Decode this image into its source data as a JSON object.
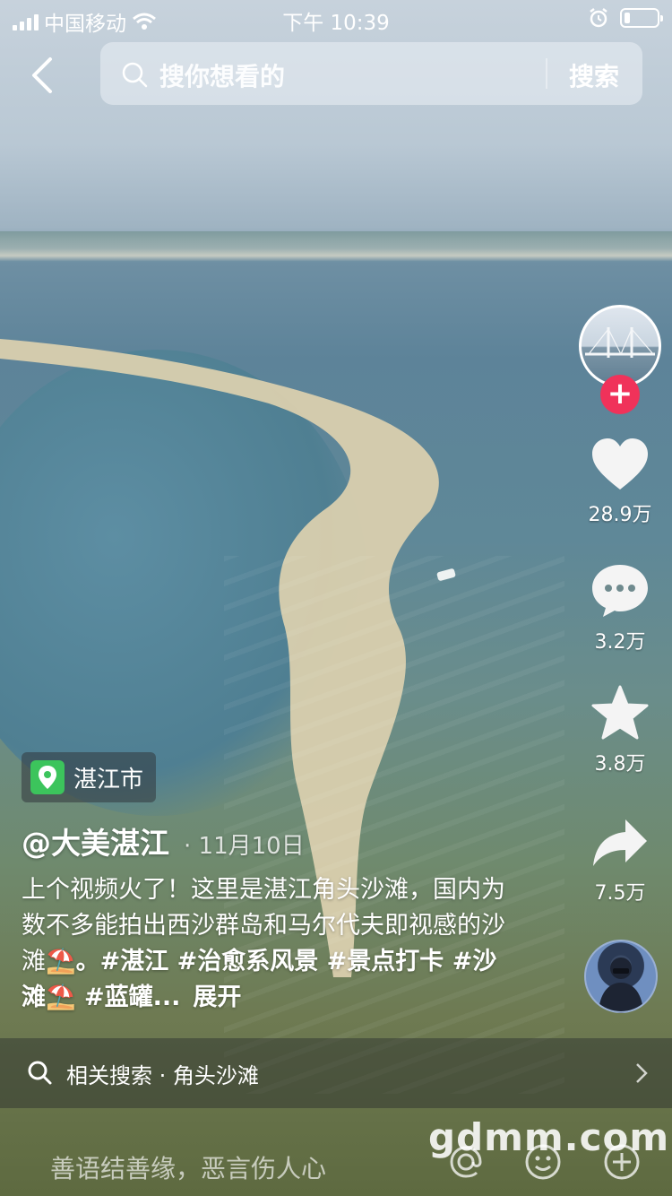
{
  "status_bar": {
    "carrier": "中国移动",
    "time": "下午 10:39",
    "battery_level": 0.18
  },
  "header": {
    "search_placeholder": "搜你想看的",
    "search_button": "搜索"
  },
  "actions": {
    "likes": "28.9万",
    "comments": "3.2万",
    "favorites": "3.8万",
    "shares": "7.5万"
  },
  "video": {
    "location": "湛江市",
    "author": "@大美湛江",
    "date": "· 11月10日",
    "description_text": "上个视频火了！这里是湛江角头沙滩，国内为数不多能拍出西沙群岛和马尔代夫即视感的沙滩",
    "description_emoji": "⛱️",
    "description_tags_1": "。#湛江 #治愈系风景 #景点打卡 #沙滩",
    "description_tags_2": " #蓝罐...",
    "expand": "展开"
  },
  "related_search": {
    "label": "相关搜索 · 角头沙滩"
  },
  "comment_bar": {
    "placeholder": "善语结善缘，恶言伤人心"
  },
  "watermark": "gdmm.com",
  "colors": {
    "follow_badge": "#f0325a",
    "location_pin": "#3cc45c"
  }
}
